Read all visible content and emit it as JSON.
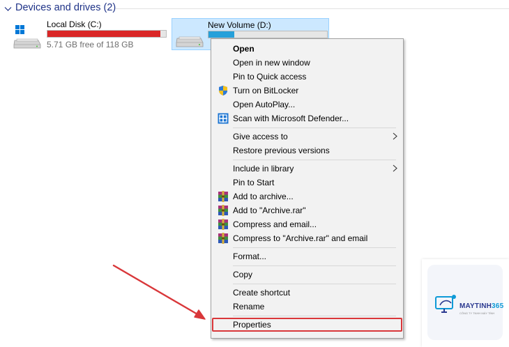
{
  "group": {
    "title": "Devices and drives (2)",
    "icon": "chevron-down-icon"
  },
  "drives": [
    {
      "name": "Local Disk (C:)",
      "free_text": "5.71 GB free of 118 GB",
      "used_fraction": 0.952,
      "bar_color": "#da2626",
      "icon": "windows-drive-icon",
      "selected": false
    },
    {
      "name": "New Volume (D:)",
      "free_text": "",
      "used_fraction": 0.22,
      "bar_color": "#26a0da",
      "icon": "drive-icon",
      "selected": true
    }
  ],
  "context_menu": {
    "groups": [
      [
        {
          "label": "Open",
          "bold": true
        },
        {
          "label": "Open in new window"
        },
        {
          "label": "Pin to Quick access"
        },
        {
          "label": "Turn on BitLocker",
          "icon": "bitlocker-shield-icon"
        },
        {
          "label": "Open AutoPlay..."
        },
        {
          "label": "Scan with Microsoft Defender...",
          "icon": "defender-icon"
        }
      ],
      [
        {
          "label": "Give access to",
          "submenu": true
        },
        {
          "label": "Restore previous versions"
        }
      ],
      [
        {
          "label": "Include in library",
          "submenu": true
        },
        {
          "label": "Pin to Start"
        },
        {
          "label": "Add to archive...",
          "icon": "winrar-icon"
        },
        {
          "label": "Add to \"Archive.rar\"",
          "icon": "winrar-icon"
        },
        {
          "label": "Compress and email...",
          "icon": "winrar-icon"
        },
        {
          "label": "Compress to \"Archive.rar\" and email",
          "icon": "winrar-icon"
        }
      ],
      [
        {
          "label": "Format..."
        }
      ],
      [
        {
          "label": "Copy"
        }
      ],
      [
        {
          "label": "Create shortcut"
        },
        {
          "label": "Rename"
        }
      ],
      [
        {
          "label": "Properties",
          "highlighted": true
        }
      ]
    ]
  },
  "annotation": {
    "arrow_color": "#d9373a",
    "highlight_color": "#d9373a"
  },
  "watermark": {
    "brand_prefix": "MAYTINH",
    "brand_number": "365",
    "tagline": "CÔNG TY TNHH MÁY TÍNH"
  }
}
